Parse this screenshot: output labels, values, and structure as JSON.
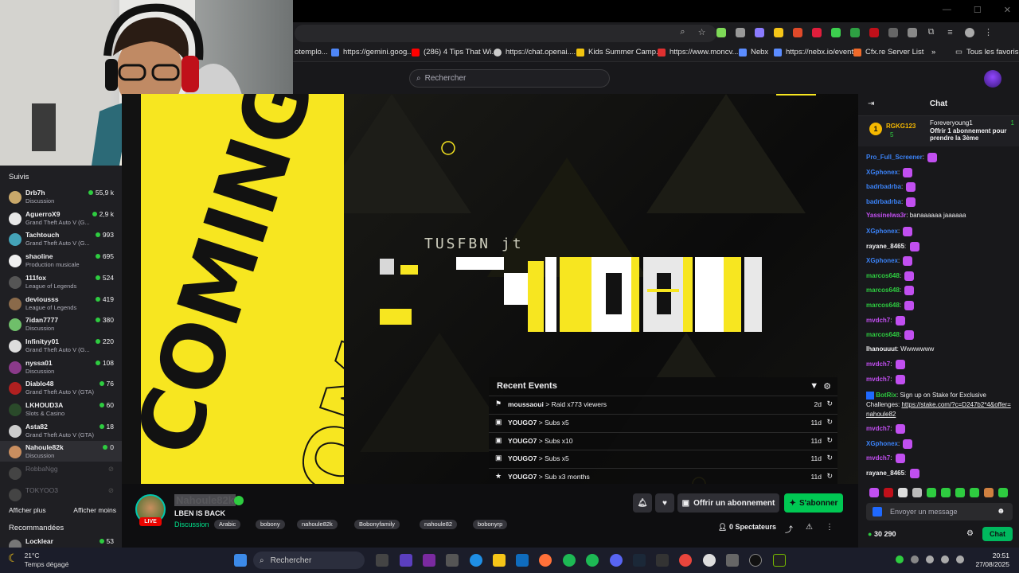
{
  "browser": {
    "bookmarks": [
      {
        "label": "otemplo...",
        "color": "#777"
      },
      {
        "label": "https://gemini.goog...",
        "color": "#4e86f7"
      },
      {
        "label": "(286) 4 Tips That Wi...",
        "color": "#ff0000"
      },
      {
        "label": "https://chat.openai....",
        "color": "#cccccc"
      },
      {
        "label": "Kids Summer Camp...",
        "color": "#f1c40f"
      },
      {
        "label": "https://www.moncv...",
        "color": "#e03030"
      },
      {
        "label": "Nebx",
        "color": "#5b8cff"
      },
      {
        "label": "https://nebx.io/event",
        "color": "#5b8cff"
      },
      {
        "label": "Cfx.re Server List",
        "color": "#f06a2a"
      }
    ],
    "bookmarks_more": "»",
    "all_bookmarks": "Tous les favoris",
    "window_controls": [
      "—",
      "☐",
      "✕"
    ]
  },
  "twitch": {
    "search_placeholder": "Rechercher",
    "sidebar": {
      "followed_title": "Suivis",
      "channels": [
        {
          "name": "Drb7h",
          "game": "Discussion",
          "viewers": "55,9 k",
          "color": "#c9a86a"
        },
        {
          "name": "AguerroX9",
          "game": "Grand Theft Auto V (G...",
          "viewers": "2,9 k",
          "color": "#e8e8e8"
        },
        {
          "name": "Tachtouch",
          "game": "Grand Theft Auto V (G...",
          "viewers": "993",
          "color": "#44a3b8"
        },
        {
          "name": "shaoline",
          "game": "Production musicale",
          "viewers": "695",
          "color": "#f0f0f0"
        },
        {
          "name": "111fox",
          "game": "League of Legends",
          "viewers": "524",
          "color": "#555"
        },
        {
          "name": "deviousss",
          "game": "League of Legends",
          "viewers": "419",
          "color": "#8a6a4a"
        },
        {
          "name": "7idan7777",
          "game": "Discussion",
          "viewers": "380",
          "color": "#6fbf6a"
        },
        {
          "name": "Infinityy01",
          "game": "Grand Theft Auto V (G...",
          "viewers": "220",
          "color": "#ddd"
        },
        {
          "name": "nyssa01",
          "game": "Discussion",
          "viewers": "108",
          "color": "#8a3a8a"
        },
        {
          "name": "Diablo48",
          "game": "Grand Theft Auto V (GTA)",
          "viewers": "76",
          "color": "#b02020"
        },
        {
          "name": "LKHOUD3A",
          "game": "Slots & Casino",
          "viewers": "60",
          "color": "#2a4a2a"
        },
        {
          "name": "Asta82",
          "game": "Grand Theft Auto V (GTA)",
          "viewers": "18",
          "color": "#ccc"
        },
        {
          "name": "Nahoule82k",
          "game": "Discussion",
          "viewers": "0",
          "color": "#c98e5f",
          "selected": true
        },
        {
          "name": "RobbaNgg",
          "game": "",
          "viewers": "",
          "color": "#444",
          "offline": true
        },
        {
          "name": "TOKYOO3",
          "game": "",
          "viewers": "",
          "color": "#444",
          "offline": true
        }
      ],
      "show_more": "Afficher plus",
      "show_less": "Afficher moins",
      "recommended_title": "Recommandées",
      "recommended": [
        {
          "name": "Locklear",
          "viewers": "53",
          "color": "#777"
        }
      ]
    },
    "stream": {
      "overlay_text": "TUSFBN jt",
      "coming_soon": "COMING SOON",
      "recent_events": {
        "title": "Recent Events",
        "events": [
          {
            "user": "moussaoui",
            "detail": "> Raid x773 viewers",
            "age": "2d",
            "icon": "raid"
          },
          {
            "user": "YOUGO7",
            "detail": "> Subs x5",
            "age": "11d",
            "icon": "gift"
          },
          {
            "user": "YOUGO7",
            "detail": "> Subs x10",
            "age": "11d",
            "icon": "gift"
          },
          {
            "user": "YOUGO7",
            "detail": "> Subs x5",
            "age": "11d",
            "icon": "gift"
          },
          {
            "user": "YOUGO7",
            "detail": "> Sub x3 months",
            "age": "11d",
            "icon": "star"
          }
        ]
      }
    },
    "channel": {
      "name": "Nahoule82k",
      "live": "LIVE",
      "title": "LBEN IS BACK",
      "category": "Discussion",
      "tags": [
        "Arabic",
        "bobony",
        "nahoule82k",
        "Bobonyfamily",
        "nahoule82",
        "bobonyrp"
      ],
      "gift_button": "Offrir un abonnement",
      "subscribe_button": "S'abonner",
      "viewers": "0 Spectateurs"
    },
    "chat": {
      "title": "Chat",
      "pinned": {
        "top_user": "RGKG123",
        "top_count": "5",
        "gifter": "Foreveryoung1",
        "gift_count": "1",
        "gift_text": "Offrir 1 abonnement pour prendre la 3ème"
      },
      "messages": [
        {
          "user": "Pro_Full_Screener",
          "color": "#3b82f6",
          "text": "",
          "emote": true
        },
        {
          "user": "XGphonex",
          "color": "#3b82f6",
          "text": "",
          "emote": true
        },
        {
          "user": "badrbadrba",
          "color": "#3b82f6",
          "text": "",
          "emote": true
        },
        {
          "user": "badrbadrba",
          "color": "#3b82f6",
          "text": "",
          "emote": true
        },
        {
          "user": "Yassinelwa3r",
          "color": "#c14ff0",
          "text": "banaaaaaa jaaaaaa",
          "emote": false
        },
        {
          "user": "XGphonex",
          "color": "#3b82f6",
          "text": "",
          "emote": true
        },
        {
          "user": "rayane_8465",
          "color": "#efeff1",
          "text": "",
          "emote": true
        },
        {
          "user": "XGphonex",
          "color": "#3b82f6",
          "text": "",
          "emote": true
        },
        {
          "user": "marcos648",
          "color": "#2ecc40",
          "text": "",
          "emote": true
        },
        {
          "user": "marcos648",
          "color": "#2ecc40",
          "text": "",
          "emote": true
        },
        {
          "user": "marcos648",
          "color": "#2ecc40",
          "text": "",
          "emote": true
        },
        {
          "user": "mvdch7",
          "color": "#c14ff0",
          "text": "",
          "emote": true
        },
        {
          "user": "marcos648",
          "color": "#2ecc40",
          "text": "",
          "emote": true
        },
        {
          "user": "lhanouuut",
          "color": "#efeff1",
          "text": "Wwwwwww",
          "emote": false
        },
        {
          "user": "mvdch7",
          "color": "#c14ff0",
          "text": "",
          "emote": true
        },
        {
          "user": "mvdch7",
          "color": "#c14ff0",
          "text": "",
          "emote": true
        }
      ],
      "bot": {
        "user": "BotRix",
        "text": "Sign up on Stake for Exclusive Challenges:",
        "link": "https://stake.com/?c=D247b2*4&offer=nahoule82"
      },
      "messages_after": [
        {
          "user": "mvdch7",
          "color": "#c14ff0",
          "text": "",
          "emote": true
        },
        {
          "user": "XGphonex",
          "color": "#3b82f6",
          "text": "",
          "emote": true
        },
        {
          "user": "mvdch7",
          "color": "#c14ff0",
          "text": "",
          "emote": true
        },
        {
          "user": "rayane_8465",
          "color": "#efeff1",
          "text": "",
          "emote": true
        }
      ],
      "input_placeholder": "Envoyer un message",
      "points": "30 290",
      "chat_button": "Chat"
    }
  },
  "taskbar": {
    "weather_temp": "21°C",
    "weather_desc": "Temps dégagé",
    "search": "Rechercher",
    "time": "20:51",
    "date": "27/08/2025"
  },
  "colors": {
    "twitch_purple": "#9146ff",
    "yellow": "#f7e620",
    "green": "#00b85e"
  }
}
